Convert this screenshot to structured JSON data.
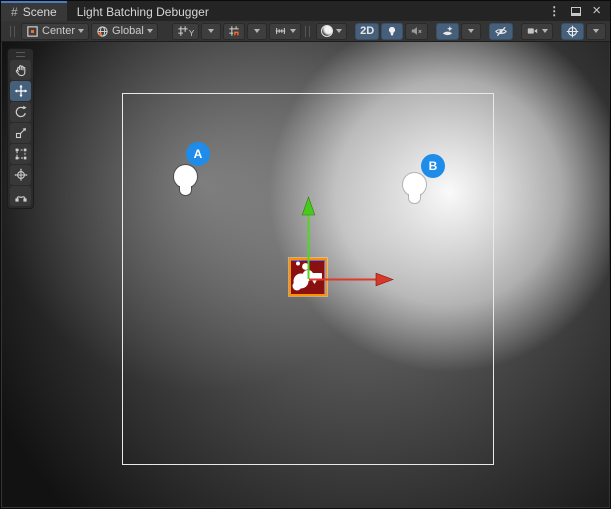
{
  "window": {
    "tabs": [
      {
        "label": "Scene",
        "active": true
      },
      {
        "label": "Light Batching Debugger",
        "active": false
      }
    ],
    "controls": {
      "menu_glyph": "⋮",
      "close_glyph": "×"
    }
  },
  "icons": {
    "scene_tab_glyph": "#",
    "right_toggles": [
      "shading-mode-sphere",
      "mode-2d",
      "scene-lighting-bulb",
      "audio-muted",
      "effects",
      "scene-visibility-eye-slash",
      "camera",
      "gizmos-axis"
    ],
    "grid_group": [
      "grid-visibility-y",
      "grid-snapping",
      "snap-increment-ruler"
    ]
  },
  "toolbar": {
    "pivot_label": "Center",
    "orientation_label": "Global",
    "grid_axis_letter": "Y",
    "mode_2d_label": "2D",
    "active_toggles": [
      "2D",
      "scene-lighting",
      "effects",
      "scene-visibility",
      "gizmos"
    ]
  },
  "tool_palette": {
    "tools": [
      "view-hand",
      "move",
      "rotate",
      "scale",
      "rect",
      "transform",
      "custom-tool"
    ],
    "selected": "move"
  },
  "scene": {
    "lights": [
      {
        "label": "A"
      },
      {
        "label": "B"
      }
    ],
    "selected_object": "red-sprite",
    "gizmo_mode": "move",
    "camera_bounds": "white-rectangle"
  },
  "colors": {
    "tab_accent_blue": "#4a7cc2",
    "toggle_active_blue": "#46607c",
    "light_badge_blue": "#1e8ce8",
    "axis_y_green": "#53d623",
    "axis_x_red": "#e0382b",
    "sprite_red": "#8a1010",
    "selection_orange": "#ff9000",
    "camera_bounds_white": "#e9e9e9"
  }
}
